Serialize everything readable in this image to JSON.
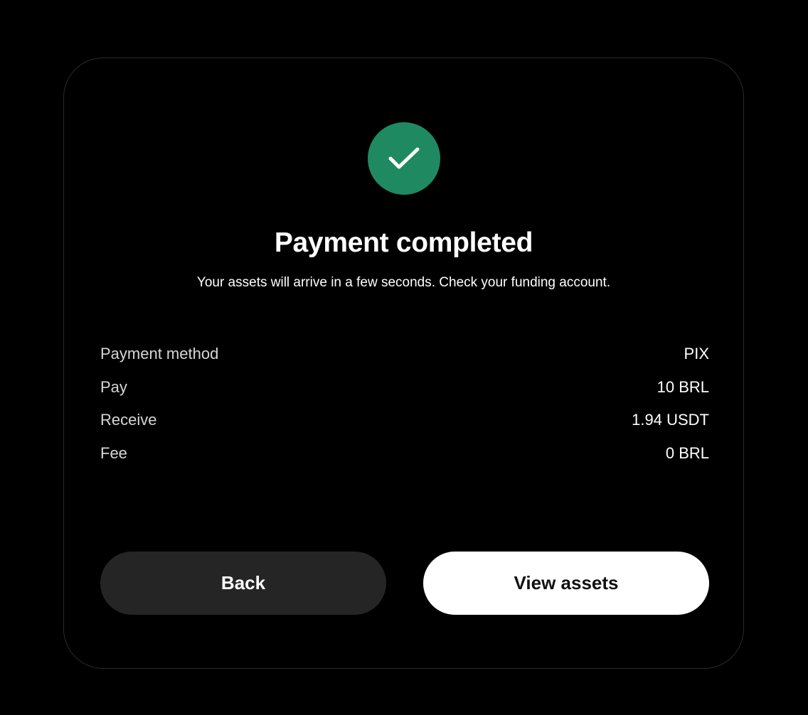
{
  "status": {
    "icon": "checkmark-icon",
    "color": "#1f8a62",
    "title": "Payment completed",
    "message": "Your assets will arrive in a few seconds. Check your funding account."
  },
  "details": [
    {
      "label": "Payment method",
      "value": "PIX"
    },
    {
      "label": "Pay",
      "value": "10 BRL"
    },
    {
      "label": "Receive",
      "value": "1.94 USDT"
    },
    {
      "label": "Fee",
      "value": "0 BRL"
    }
  ],
  "actions": {
    "back_label": "Back",
    "view_assets_label": "View assets"
  }
}
